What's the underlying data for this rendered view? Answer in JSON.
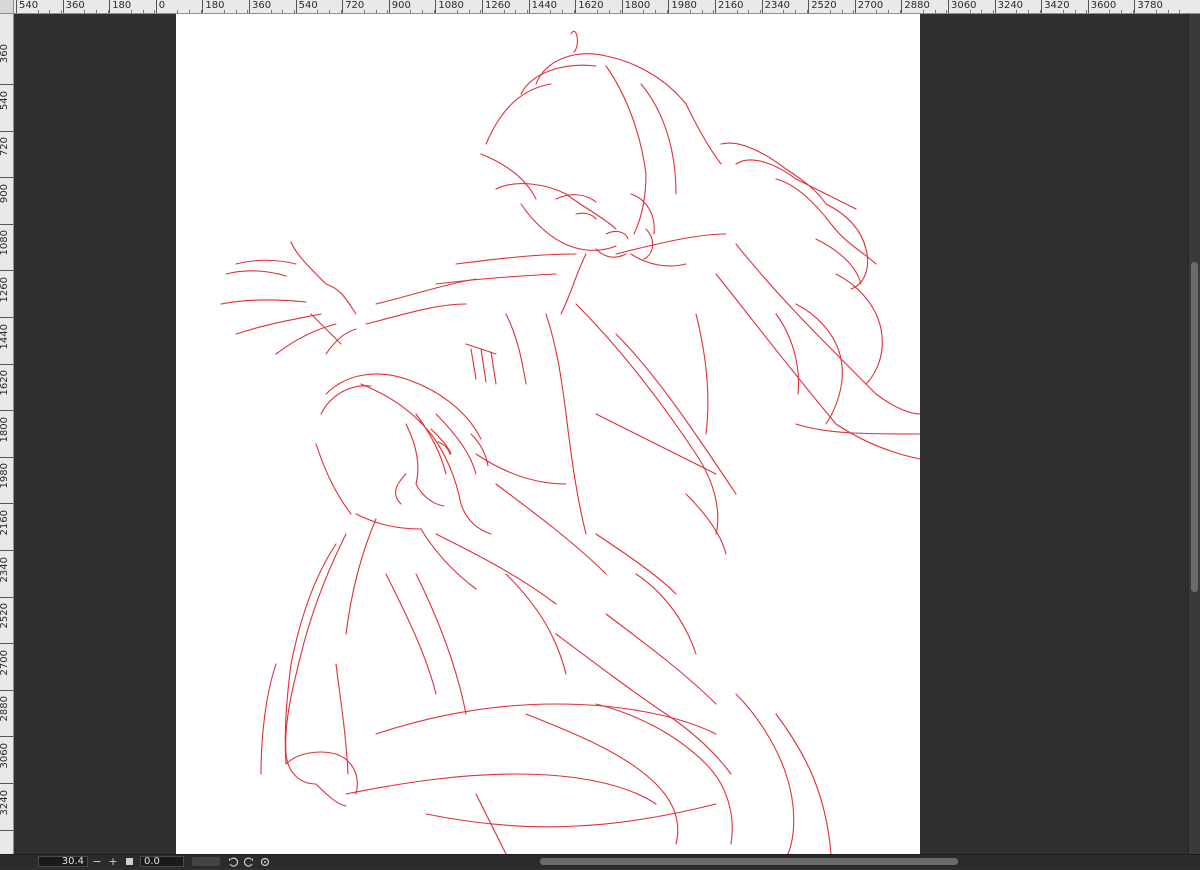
{
  "rulers": {
    "top_labels": [
      "540",
      "360",
      "180",
      "0",
      "180",
      "360",
      "540",
      "720",
      "900",
      "1080",
      "1260",
      "1440",
      "1620",
      "1800",
      "1980",
      "2160",
      "2340",
      "2520",
      "2700",
      "2880",
      "3060",
      "3240",
      "3420",
      "3600",
      "3780"
    ],
    "left_labels": [
      "360",
      "540",
      "720",
      "900",
      "1080",
      "1260",
      "1440",
      "1620",
      "1800",
      "1980",
      "2160",
      "2340",
      "2520",
      "2700",
      "2880",
      "3060",
      "3240"
    ]
  },
  "canvas": {
    "background": "#ffffff",
    "workspace_color": "#2f2f2f",
    "stroke_color": "#e0303a",
    "content": "red line sketch"
  },
  "status_bar": {
    "zoom": "30.4",
    "zoom_out_label": "−",
    "zoom_in_label": "+",
    "fit_icon": "square-icon",
    "rotation": "0.0",
    "rotate_left_icon": "rotate-left-icon",
    "rotate_right_icon": "rotate-right-icon",
    "reset_rotation_icon": "reset-rotation-icon"
  }
}
